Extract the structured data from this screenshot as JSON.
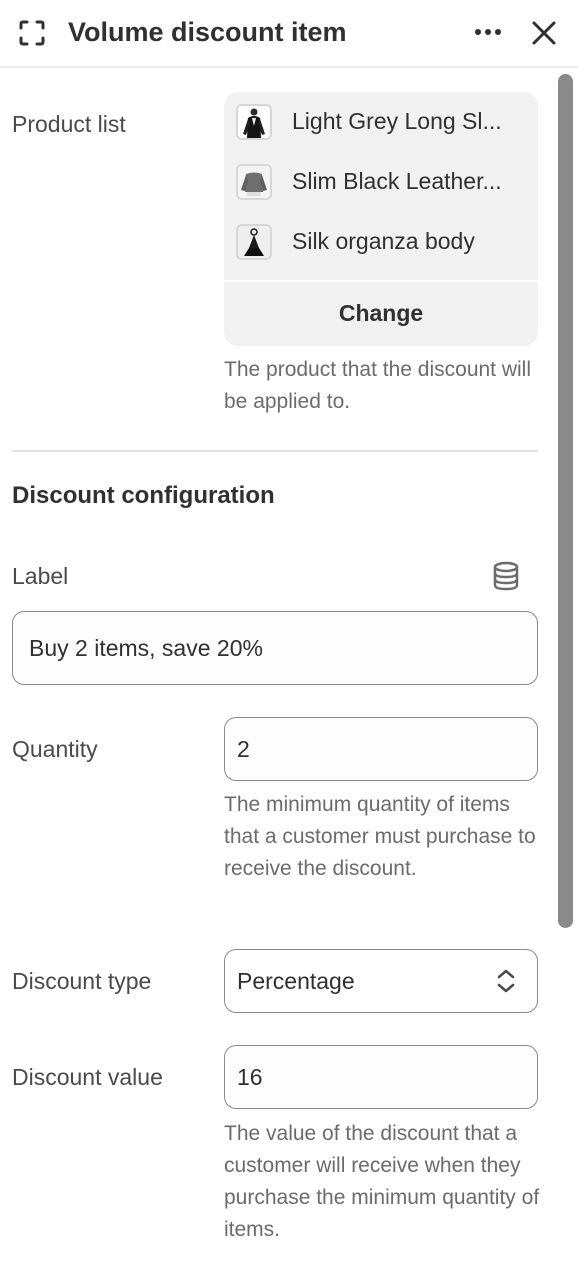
{
  "header": {
    "title": "Volume discount item",
    "focus_icon": "focus-frame-icon",
    "more_icon": "more-horizontal-icon",
    "close_icon": "close-icon"
  },
  "product_list": {
    "label": "Product list",
    "items": [
      {
        "name": "Light Grey Long Sl...",
        "thumbnail_icon": "product-thumbnail-black-jacket"
      },
      {
        "name": "Slim Black Leather...",
        "thumbnail_icon": "product-thumbnail-grey-sweater"
      },
      {
        "name": "Silk organza body",
        "thumbnail_icon": "product-thumbnail-black-body"
      }
    ],
    "change_label": "Change",
    "help_text": "The product that the discount will be applied to."
  },
  "discount_configuration": {
    "title": "Discount configuration",
    "label_field": {
      "label": "Label",
      "value": "Buy 2 items, save 20%",
      "icon": "database-icon"
    },
    "quantity_field": {
      "label": "Quantity",
      "value": "2",
      "help_text": "The minimum quantity of items that a customer must purchase to receive the discount."
    },
    "discount_type_field": {
      "label": "Discount type",
      "selected": "Percentage",
      "icon": "select-chevrons-icon"
    },
    "discount_value_field": {
      "label": "Discount value",
      "value": "16",
      "help_text": "The value of the discount that a customer will receive when they purchase the minimum quantity of items."
    }
  },
  "colors": {
    "text_primary": "#303030",
    "text_secondary": "#6b6b6b",
    "card_background": "#f1f1f1",
    "input_border": "#8a8a8a",
    "scrollbar": "#8a8a8a"
  }
}
